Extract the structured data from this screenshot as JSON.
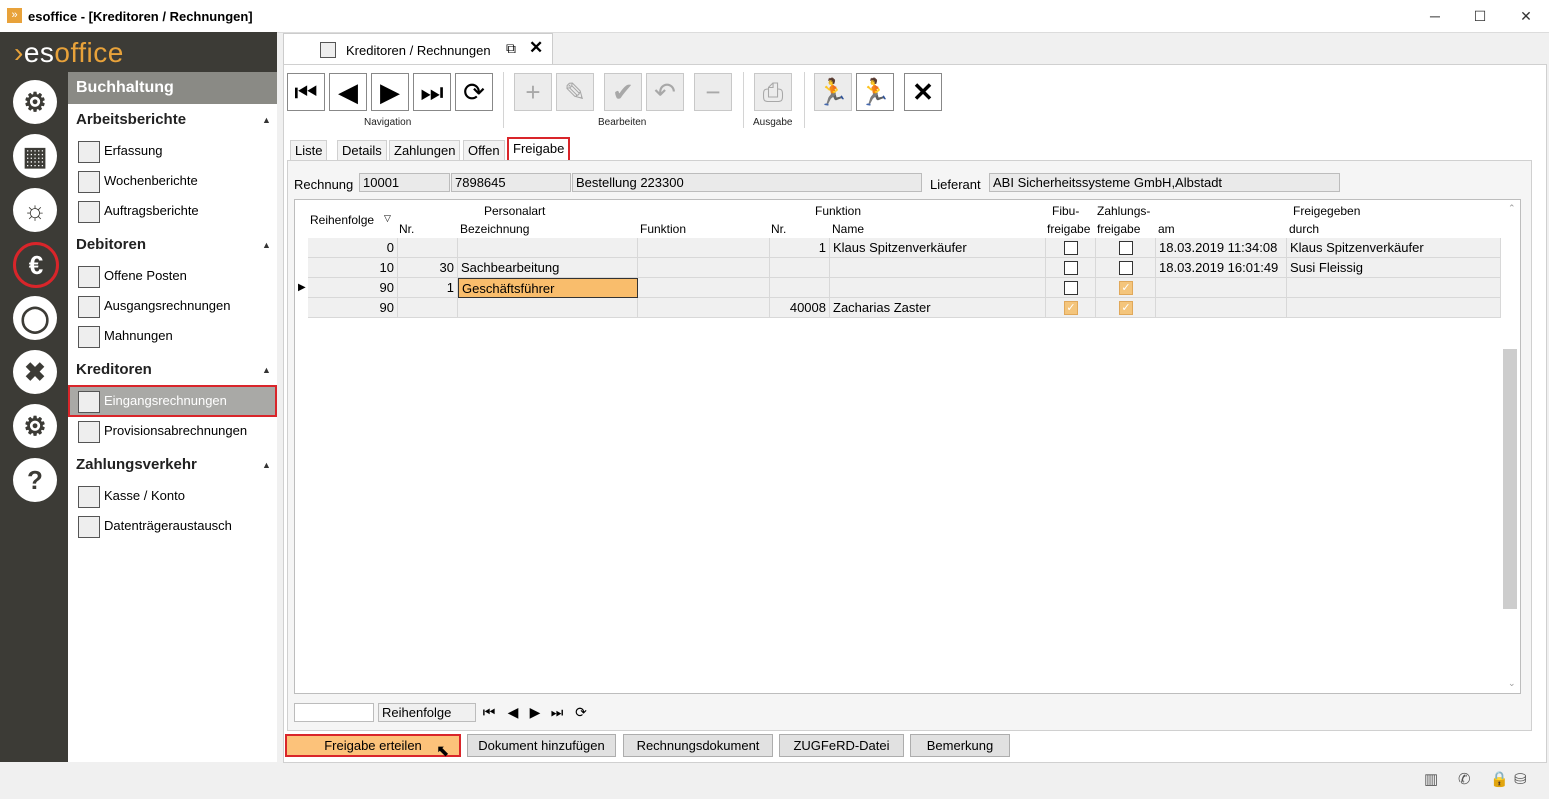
{
  "window": {
    "title": "esoffice - [Kreditoren / Rechnungen]",
    "min": "─",
    "max": "☐",
    "close": "✕"
  },
  "logo": {
    "prefix": "es",
    "suffix": "office"
  },
  "rail": [
    "⚙",
    "▦",
    "☼",
    "€",
    "◯",
    "✖",
    "⚙",
    "?"
  ],
  "nav": {
    "header": "Buchhaltung",
    "sections": {
      "arbeitsberichte": "Arbeitsberichte",
      "debitoren": "Debitoren",
      "kreditoren": "Kreditoren",
      "zahlungsverkehr": "Zahlungsverkehr"
    },
    "items": {
      "erfassung": "Erfassung",
      "wochenberichte": "Wochenberichte",
      "auftragsberichte": "Auftragsberichte",
      "offene_posten": "Offene Posten",
      "ausgangsrechnungen": "Ausgangsrechnungen",
      "mahnungen": "Mahnungen",
      "eingangsrechnungen": "Eingangsrechnungen",
      "provisionsabrechnungen": "Provisionsabrechnungen",
      "kasse_konto": "Kasse / Konto",
      "datentraegeraustausch": "Datenträgeraustausch"
    }
  },
  "doc_tab": {
    "label": "Kreditoren / Rechnungen"
  },
  "toolbar": {
    "navigation": "Navigation",
    "bearbeiten": "Bearbeiten",
    "ausgabe": "Ausgabe"
  },
  "subtabs": {
    "liste": "Liste",
    "details": "Details",
    "zahlungen": "Zahlungen",
    "offen": "Offen",
    "freigabe": "Freigabe"
  },
  "form": {
    "rechnung_label": "Rechnung",
    "rechnung_nr": "10001",
    "rechnung_ref": "7898645",
    "rechnung_text": "Bestellung 223300",
    "lieferant_label": "Lieferant",
    "lieferant": "ABI Sicherheitssysteme GmbH,Albstadt"
  },
  "grid": {
    "headers": {
      "reihenfolge": "Reihenfolge",
      "personalart": "Personalart",
      "nr": "Nr.",
      "bezeichnung": "Bezeichnung",
      "funktion": "Funktion",
      "funktion_sub": "Funktion",
      "nr2": "Nr.",
      "name": "Name",
      "fibu1": "Fibu-",
      "fibu2": "freigabe",
      "zahl1": "Zahlungs-",
      "zahl2": "freigabe",
      "freigegeben": "Freigegeben",
      "am": "am",
      "durch": "durch"
    },
    "rows": [
      {
        "reihenfolge": "0",
        "pnr": "",
        "bez": "",
        "funktion": "",
        "nr": "1",
        "name": "Klaus Spitzenverkäufer",
        "am": "18.03.2019 11:34:08",
        "durch": "Klaus Spitzenverkäufer"
      },
      {
        "reihenfolge": "10",
        "pnr": "30",
        "bez": "Sachbearbeitung",
        "funktion": "",
        "nr": "",
        "name": "",
        "am": "18.03.2019 16:01:49",
        "durch": "Susi Fleissig"
      },
      {
        "reihenfolge": "90",
        "pnr": "1",
        "bez": "Geschäftsführer",
        "funktion": "",
        "nr": "",
        "name": "",
        "am": "",
        "durch": ""
      },
      {
        "reihenfolge": "90",
        "pnr": "",
        "bez": "",
        "funktion": "",
        "nr": "40008",
        "name": "Zacharias Zaster",
        "am": "",
        "durch": ""
      }
    ]
  },
  "gridnav": {
    "field": "Reihenfolge"
  },
  "buttons": {
    "freigabe": "Freigabe erteilen",
    "dokument": "Dokument hinzufügen",
    "rechnungsdokument": "Rechnungsdokument",
    "zugferd": "ZUGFeRD-Datei",
    "bemerkung": "Bemerkung"
  },
  "colors": {
    "accent": "#e8a23a",
    "highlight": "#fcc27a",
    "selection_border": "#d9252a",
    "rail": "#3c3b36"
  }
}
